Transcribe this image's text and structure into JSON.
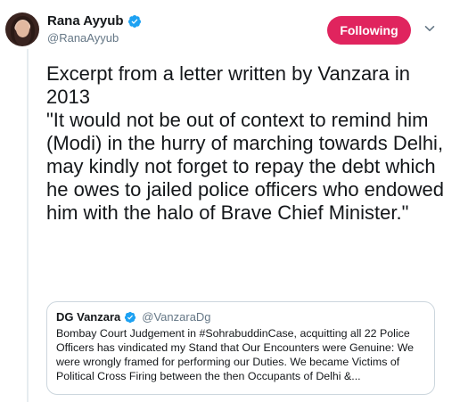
{
  "author": {
    "name": "Rana Ayyub",
    "handle": "@RanaAyyub",
    "verified_icon": "verified-badge-icon"
  },
  "follow_button": {
    "label": "Following",
    "color": "#e0245e"
  },
  "menu": {
    "icon": "chevron-down-icon"
  },
  "tweet": {
    "text": "Excerpt from a letter written by Vanzara in 2013\n\"It would not be out of context to remind him (Modi) in the hurry of marching towards Delhi, may kindly not forget to repay the debt which he owes to jailed police officers who endowed him with the halo of Brave Chief Minister.\""
  },
  "quoted_tweet": {
    "name": "DG Vanzara",
    "handle": "@VanzaraDg",
    "text": "Bombay Court Judgement in #SohrabuddinCase, acquitting all 22 Police Officers has vindicated my Stand that Our Encounters were Genuine: We were wrongly framed for performing our Duties. We became Victims of Political Cross Firing between the then Occupants of Delhi &..."
  },
  "colors": {
    "verified": "#1da1f2",
    "text": "#14171a",
    "muted": "#657786"
  }
}
